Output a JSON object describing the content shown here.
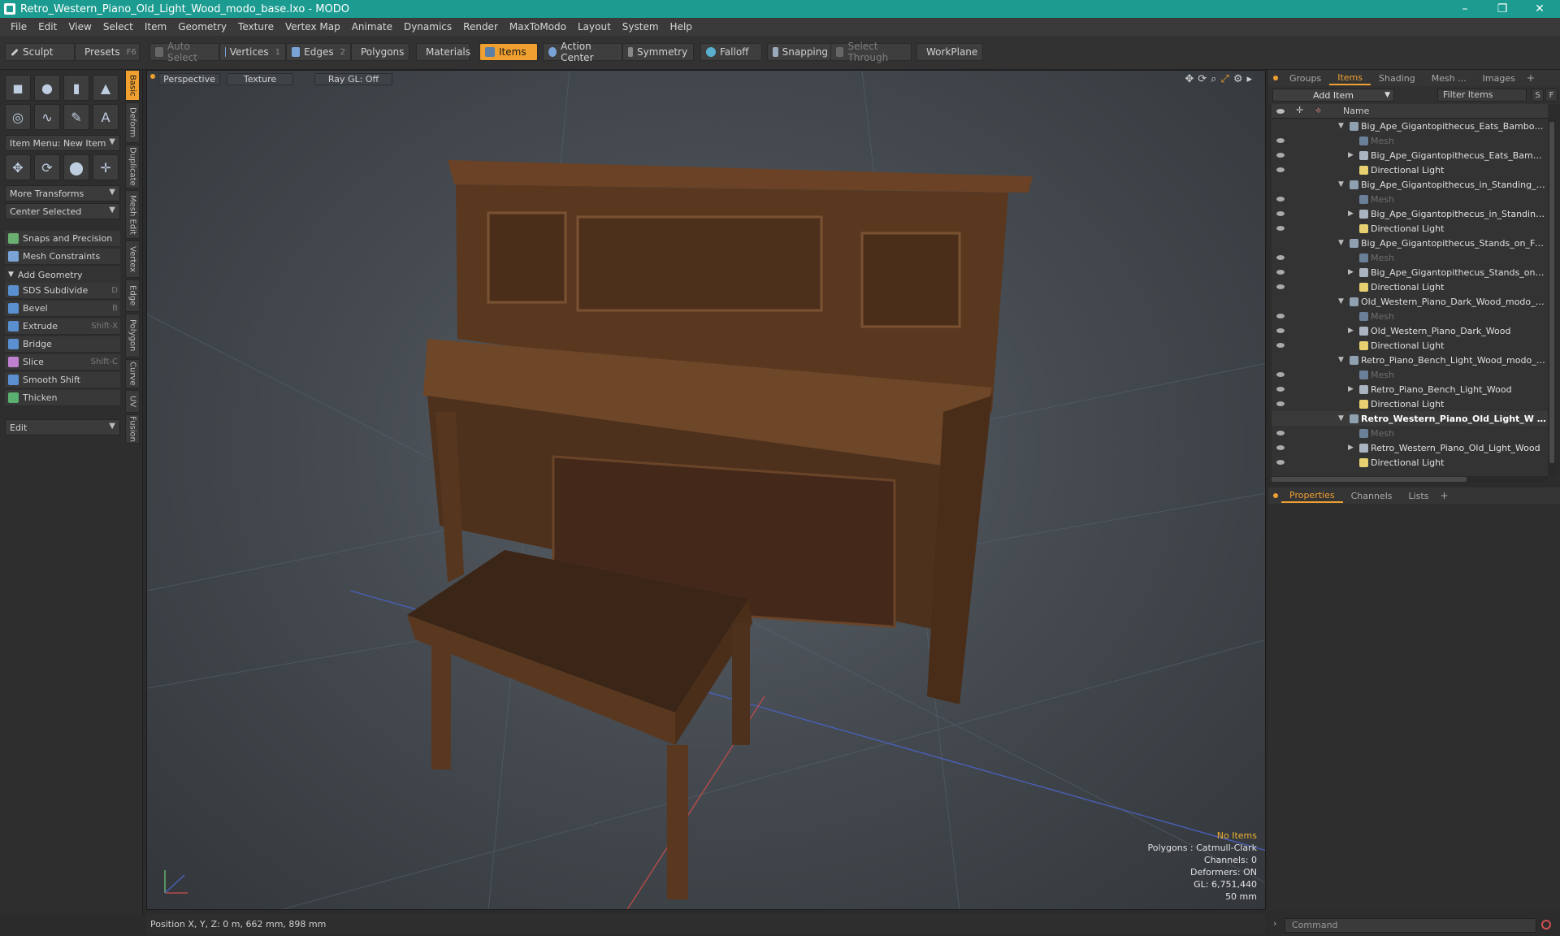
{
  "window": {
    "title": "Retro_Western_Piano_Old_Light_Wood_modo_base.lxo - MODO",
    "minimize": "–",
    "maximize": "❐",
    "close": "✕"
  },
  "menu": [
    "File",
    "Edit",
    "View",
    "Select",
    "Item",
    "Geometry",
    "Texture",
    "Vertex Map",
    "Animate",
    "Dynamics",
    "Render",
    "MaxToModo",
    "Layout",
    "System",
    "Help"
  ],
  "toolbar": {
    "sculpt": "Sculpt",
    "presets": "Presets",
    "presets_key": "F6",
    "auto_select": "Auto Select",
    "vertices": "Vertices",
    "vertices_key": "1",
    "edges": "Edges",
    "edges_key": "2",
    "polygons": "Polygons",
    "materials": "Materials",
    "items": "Items",
    "action_center": "Action Center",
    "symmetry": "Symmetry",
    "falloff": "Falloff",
    "snapping": "Snapping",
    "select_through": "Select Through",
    "workplane": "WorkPlane"
  },
  "left": {
    "item_menu": "Item Menu: New Item",
    "more_transforms": "More Transforms",
    "center_selected": "Center Selected",
    "snaps": "Snaps and Precision",
    "mesh_constraints": "Mesh Constraints",
    "add_geometry": "Add Geometry",
    "tools": [
      {
        "label": "SDS Subdivide",
        "key": "D",
        "color": "#5a8fd0"
      },
      {
        "label": "Bevel",
        "key": "B",
        "color": "#5a8fd0"
      },
      {
        "label": "Extrude",
        "key": "Shift-X",
        "color": "#5a8fd0"
      },
      {
        "label": "Bridge",
        "key": "",
        "color": "#5a8fd0"
      },
      {
        "label": "Slice",
        "key": "Shift-C",
        "color": "#c080d0"
      },
      {
        "label": "Smooth Shift",
        "key": "",
        "color": "#5a8fd0"
      },
      {
        "label": "Thicken",
        "key": "",
        "color": "#5ab070"
      }
    ],
    "edit": "Edit",
    "vtabs": [
      "Basic",
      "Deform",
      "Duplicate",
      "Mesh Edit",
      "Vertex",
      "Edge",
      "Polygon",
      "Curve",
      "UV",
      "Fusion"
    ]
  },
  "viewport": {
    "view": "Perspective",
    "shading": "Texture",
    "raygl": "Ray GL: Off",
    "info": {
      "no_items": "No Items",
      "polygons": "Polygons : Catmull-Clark",
      "channels": "Channels: 0",
      "deformers": "Deformers: ON",
      "gl": "GL: 6,751,440",
      "size": "50 mm"
    }
  },
  "status": {
    "position": "Position X, Y, Z:  0 m, 662 mm, 898 mm"
  },
  "right": {
    "tabs": [
      "Groups",
      "Items",
      "Shading",
      "Mesh ...",
      "Images"
    ],
    "add_item": "Add Item",
    "filter": "Filter Items",
    "s_btn": "S",
    "f_btn": "F",
    "col_name": "Name",
    "tree": [
      {
        "label": "Big_Ape_Gigantopithecus_Eats_Bamboo_Pl...",
        "type": "scene",
        "indent": 0
      },
      {
        "label": "Mesh",
        "type": "mesh",
        "indent": 1
      },
      {
        "label": "Big_Ape_Gigantopithecus_Eats_Bamboo ...",
        "type": "group",
        "indent": 1
      },
      {
        "label": "Directional Light",
        "type": "light",
        "indent": 1
      },
      {
        "label": "Big_Ape_Gigantopithecus_in_Standing_Pos...",
        "type": "scene",
        "indent": 0
      },
      {
        "label": "Mesh",
        "type": "mesh",
        "indent": 1
      },
      {
        "label": "Big_Ape_Gigantopithecus_in_Standing_ ...",
        "type": "group",
        "indent": 1
      },
      {
        "label": "Directional Light",
        "type": "light",
        "indent": 1
      },
      {
        "label": "Big_Ape_Gigantopithecus_Stands_on_Four...",
        "type": "scene",
        "indent": 0
      },
      {
        "label": "Mesh",
        "type": "mesh",
        "indent": 1
      },
      {
        "label": "Big_Ape_Gigantopithecus_Stands_on_F ...",
        "type": "group",
        "indent": 1
      },
      {
        "label": "Directional Light",
        "type": "light",
        "indent": 1
      },
      {
        "label": "Old_Western_Piano_Dark_Wood_modo_ba...",
        "type": "scene",
        "indent": 0
      },
      {
        "label": "Mesh",
        "type": "mesh",
        "indent": 1
      },
      {
        "label": "Old_Western_Piano_Dark_Wood",
        "type": "group",
        "indent": 1
      },
      {
        "label": "Directional Light",
        "type": "light",
        "indent": 1
      },
      {
        "label": "Retro_Piano_Bench_Light_Wood_modo_ba...",
        "type": "scene",
        "indent": 0
      },
      {
        "label": "Mesh",
        "type": "mesh",
        "indent": 1
      },
      {
        "label": "Retro_Piano_Bench_Light_Wood",
        "type": "group",
        "indent": 1
      },
      {
        "label": "Directional Light",
        "type": "light",
        "indent": 1
      },
      {
        "label": "Retro_Western_Piano_Old_Light_W ...",
        "type": "scene",
        "indent": 0,
        "bold": true
      },
      {
        "label": "Mesh",
        "type": "mesh",
        "indent": 1
      },
      {
        "label": "Retro_Western_Piano_Old_Light_Wood",
        "type": "group",
        "indent": 1
      },
      {
        "label": "Directional Light",
        "type": "light",
        "indent": 1
      }
    ],
    "ptabs": [
      "Properties",
      "Channels",
      "Lists"
    ],
    "command_placeholder": "Command"
  },
  "colors": {
    "accent": "#f0a030",
    "titlebar": "#1c9c91"
  }
}
